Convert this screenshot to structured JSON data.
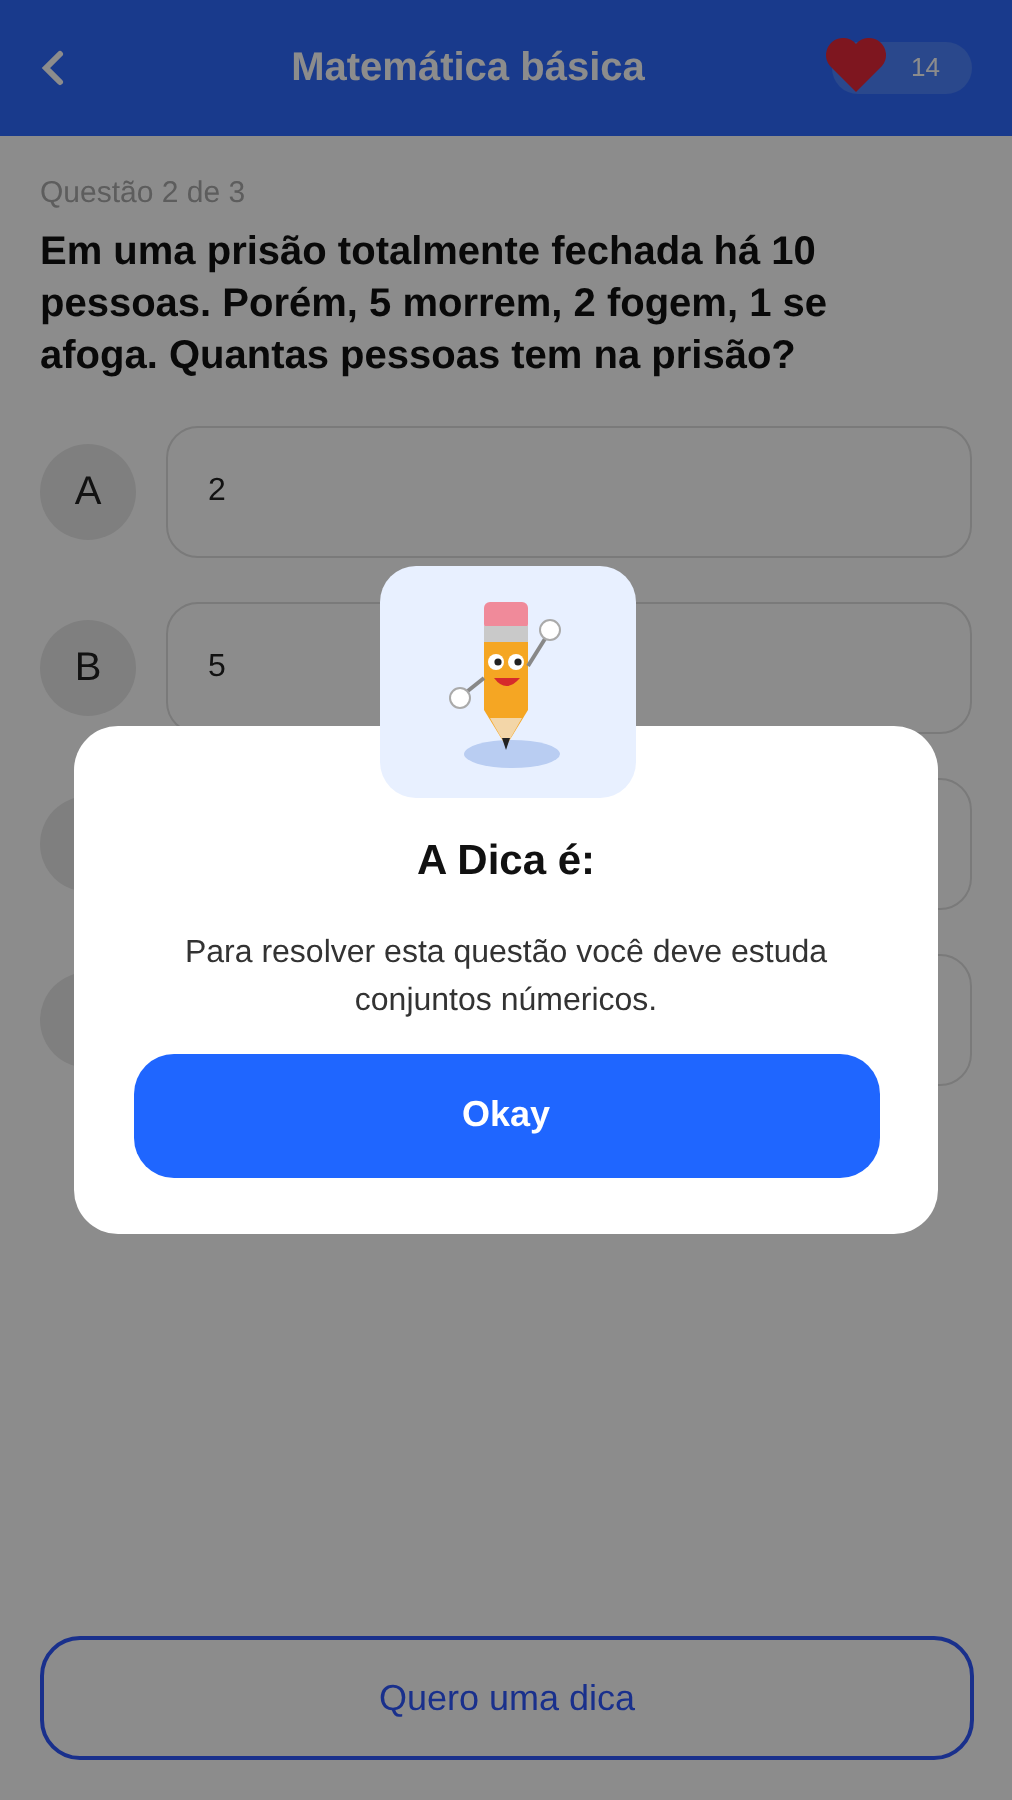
{
  "header": {
    "title": "Matemática básica",
    "lives": "14"
  },
  "question": {
    "counter": "Questão 2 de 3",
    "text": "Em uma prisão totalmente fechada há 10 pessoas. Porém, 5 morrem, 2 fogem, 1 se afoga. Quantas pessoas tem na prisão?"
  },
  "options": [
    {
      "kind": "shown",
      "letter": "A",
      "answer": "2"
    },
    {
      "kind": "shown",
      "letter": "B",
      "answer": "5"
    },
    {
      "kind": "covered"
    },
    {
      "kind": "covered"
    }
  ],
  "hint_button": "Quero uma dica",
  "dialog": {
    "title": "A Dica é:",
    "message": "Para resolver esta questão você deve estuda conjuntos númericos.",
    "button": "Okay"
  }
}
